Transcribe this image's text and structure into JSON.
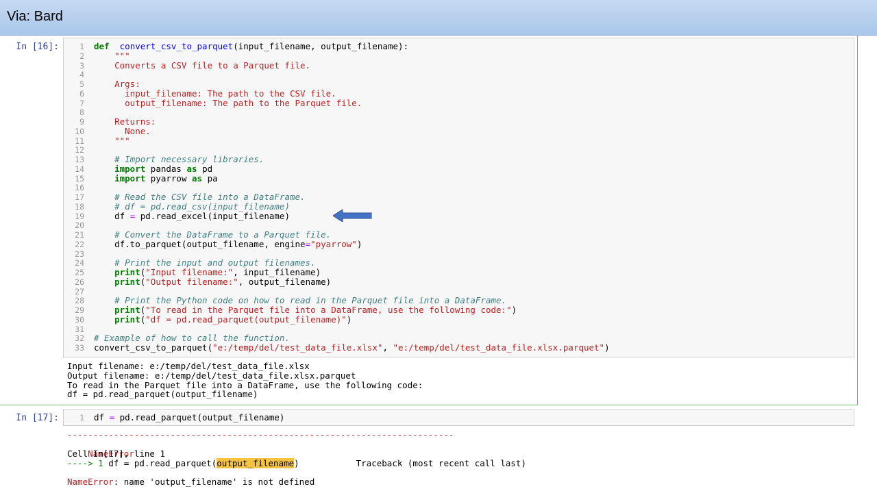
{
  "header": {
    "title": "Via: Bard"
  },
  "cell16": {
    "prompt": "In [16]:",
    "lines": [
      {
        "n": "1",
        "parts": [
          [
            "kw",
            "def"
          ],
          [
            "",
            "  "
          ],
          [
            "fn",
            "convert_csv_to_parquet"
          ],
          [
            "",
            "(input_filename, output_filename):"
          ]
        ]
      },
      {
        "n": "2",
        "parts": [
          [
            "str",
            "    \"\"\""
          ]
        ]
      },
      {
        "n": "3",
        "parts": [
          [
            "str",
            "    Converts a CSV file to a Parquet file."
          ]
        ]
      },
      {
        "n": "4",
        "parts": [
          [
            "",
            ""
          ]
        ]
      },
      {
        "n": "5",
        "parts": [
          [
            "str",
            "    Args:"
          ]
        ]
      },
      {
        "n": "6",
        "parts": [
          [
            "str",
            "      input_filename: The path to the CSV file."
          ]
        ]
      },
      {
        "n": "7",
        "parts": [
          [
            "str",
            "      output_filename: The path to the Parquet file."
          ]
        ]
      },
      {
        "n": "8",
        "parts": [
          [
            "",
            ""
          ]
        ]
      },
      {
        "n": "9",
        "parts": [
          [
            "str",
            "    Returns:"
          ]
        ]
      },
      {
        "n": "10",
        "parts": [
          [
            "str",
            "      None."
          ]
        ]
      },
      {
        "n": "11",
        "parts": [
          [
            "str",
            "    \"\"\""
          ]
        ]
      },
      {
        "n": "12",
        "parts": [
          [
            "",
            ""
          ]
        ]
      },
      {
        "n": "13",
        "parts": [
          [
            "cm",
            "    # Import necessary libraries."
          ]
        ]
      },
      {
        "n": "14",
        "parts": [
          [
            "",
            "    "
          ],
          [
            "kw-imp",
            "import"
          ],
          [
            "",
            " pandas "
          ],
          [
            "kw-imp",
            "as"
          ],
          [
            "",
            " pd"
          ]
        ]
      },
      {
        "n": "15",
        "parts": [
          [
            "",
            "    "
          ],
          [
            "kw-imp",
            "import"
          ],
          [
            "",
            " pyarrow "
          ],
          [
            "kw-imp",
            "as"
          ],
          [
            "",
            " pa"
          ]
        ]
      },
      {
        "n": "16",
        "parts": [
          [
            "",
            ""
          ]
        ]
      },
      {
        "n": "17",
        "parts": [
          [
            "cm",
            "    # Read the CSV file into a DataFrame."
          ]
        ]
      },
      {
        "n": "18",
        "parts": [
          [
            "cm",
            "    # df = pd.read_csv(input_filename)"
          ]
        ]
      },
      {
        "n": "19",
        "parts": [
          [
            "",
            "    df "
          ],
          [
            "op",
            "="
          ],
          [
            "",
            " pd.read_excel(input_filename)"
          ]
        ]
      },
      {
        "n": "20",
        "parts": [
          [
            "",
            ""
          ]
        ]
      },
      {
        "n": "21",
        "parts": [
          [
            "cm",
            "    # Convert the DataFrame to a Parquet file."
          ]
        ]
      },
      {
        "n": "22",
        "parts": [
          [
            "",
            "    df.to_parquet(output_filename, engine"
          ],
          [
            "op",
            "="
          ],
          [
            "str",
            "\"pyarrow\""
          ],
          [
            "",
            ")"
          ]
        ]
      },
      {
        "n": "23",
        "parts": [
          [
            "",
            ""
          ]
        ]
      },
      {
        "n": "24",
        "parts": [
          [
            "cm",
            "    # Print the input and output filenames."
          ]
        ]
      },
      {
        "n": "25",
        "parts": [
          [
            "",
            "    "
          ],
          [
            "kw",
            "print"
          ],
          [
            "",
            "("
          ],
          [
            "str",
            "\"Input filename:\""
          ],
          [
            "",
            ", input_filename)"
          ]
        ]
      },
      {
        "n": "26",
        "parts": [
          [
            "",
            "    "
          ],
          [
            "kw",
            "print"
          ],
          [
            "",
            "("
          ],
          [
            "str",
            "\"Output filename:\""
          ],
          [
            "",
            ", output_filename)"
          ]
        ]
      },
      {
        "n": "27",
        "parts": [
          [
            "",
            ""
          ]
        ]
      },
      {
        "n": "28",
        "parts": [
          [
            "cm",
            "    # Print the Python code on how to read in the Parquet file into a DataFrame."
          ]
        ]
      },
      {
        "n": "29",
        "parts": [
          [
            "",
            "    "
          ],
          [
            "kw",
            "print"
          ],
          [
            "",
            "("
          ],
          [
            "str",
            "\"To read in the Parquet file into a DataFrame, use the following code:\""
          ],
          [
            "",
            ")"
          ]
        ]
      },
      {
        "n": "30",
        "parts": [
          [
            "",
            "    "
          ],
          [
            "kw",
            "print"
          ],
          [
            "",
            "("
          ],
          [
            "str",
            "\"df = pd.read_parquet(output_filename)\""
          ],
          [
            "",
            ")"
          ]
        ]
      },
      {
        "n": "31",
        "parts": [
          [
            "",
            ""
          ]
        ]
      },
      {
        "n": "32",
        "parts": [
          [
            "cm",
            "# Example of how to call the function."
          ]
        ]
      },
      {
        "n": "33",
        "parts": [
          [
            "",
            "convert_csv_to_parquet("
          ],
          [
            "str",
            "\"e:/temp/del/test_data_file.xlsx\""
          ],
          [
            "",
            ", "
          ],
          [
            "str",
            "\"e:/temp/del/test_data_file.xlsx.parquet\""
          ],
          [
            "",
            ")"
          ]
        ]
      }
    ],
    "output": [
      "Input filename: e:/temp/del/test_data_file.xlsx",
      "Output filename: e:/temp/del/test_data_file.xlsx.parquet",
      "To read in the Parquet file into a DataFrame, use the following code:",
      "df = pd.read_parquet(output_filename)"
    ]
  },
  "cell17": {
    "prompt": "In [17]:",
    "line_number": "1",
    "code_parts": [
      [
        "",
        "df "
      ],
      [
        "op",
        "="
      ],
      [
        "",
        " pd.read_parquet(output_filename)"
      ]
    ],
    "error": {
      "separator": "---------------------------------------------------------------------------",
      "name": "NameError",
      "traceback_label": "Traceback (most recent call last)",
      "cell_ref": "Cell In[17], line 1",
      "arrow": "----> 1 ",
      "code_before": "df = pd.read_parquet(",
      "code_highlight": "output_filename",
      "code_after": ")",
      "message_name": "NameError",
      "message": ": name 'output_filename' is not defined"
    }
  },
  "colors": {
    "title_bar": "#aac7ea",
    "selected_cell_border": "#66bb66",
    "arrow": "#4472c4"
  }
}
